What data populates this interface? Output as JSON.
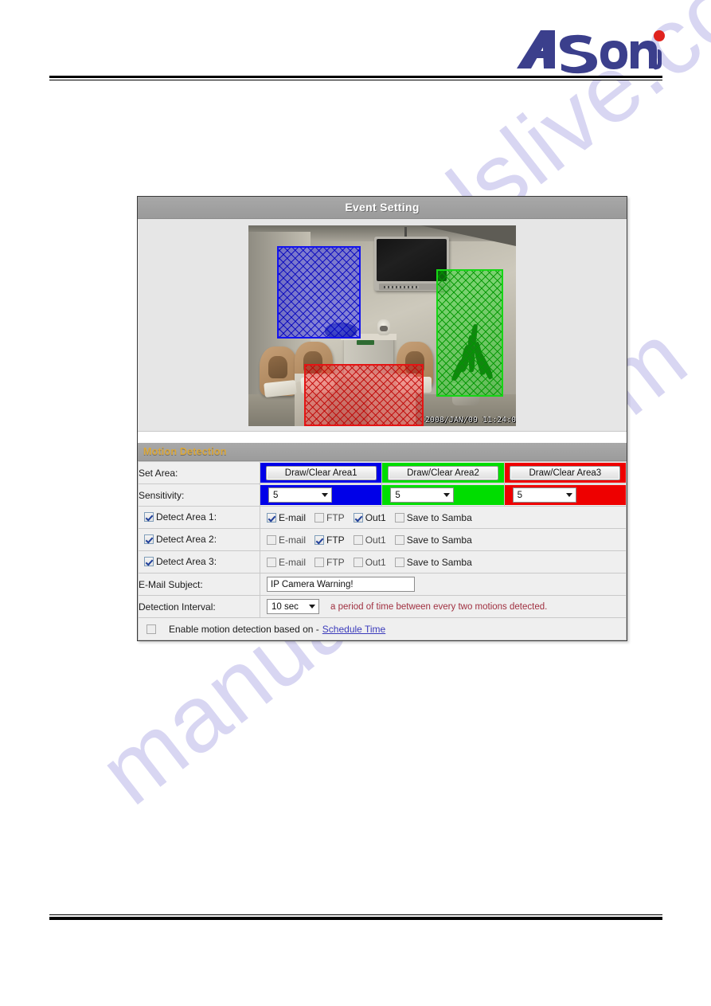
{
  "brand": {
    "logo_text": "Asoni",
    "logo_color": "#3b3f8c",
    "dot_color": "#e0231e"
  },
  "watermark": {
    "text": "manualslive.com",
    "color": "#b9b6e8"
  },
  "panel": {
    "title": "Event Setting",
    "section_title": "Motion Detection",
    "section_title_color": "#dba83c"
  },
  "video": {
    "timestamp": "2008/JAN/09 11:24:0",
    "areas": [
      {
        "name": "area-1",
        "color": "#0000e8"
      },
      {
        "name": "area-2",
        "color": "#00dd00"
      },
      {
        "name": "area-3",
        "color": "#ee0000"
      }
    ]
  },
  "rows": {
    "set_area_label": "Set Area:",
    "sensitivity_label": "Sensitivity:",
    "email_subject_label": "E-Mail Subject:",
    "detection_interval_label": "Detection Interval:"
  },
  "set_area": {
    "buttons": [
      {
        "label": "Draw/Clear Area1",
        "color": "#0000e8"
      },
      {
        "label": "Draw/Clear Area2",
        "color": "#00dd00"
      },
      {
        "label": "Draw/Clear Area3",
        "color": "#ee0000"
      }
    ]
  },
  "sensitivity": {
    "values": [
      "5",
      "5",
      "5"
    ]
  },
  "detect_areas": [
    {
      "label": "Detect Area 1:",
      "enabled": true,
      "actions": [
        {
          "label": "E-mail",
          "checked": true
        },
        {
          "label": "FTP",
          "checked": false
        },
        {
          "label": "Out1",
          "checked": true
        },
        {
          "label": "Save to Samba",
          "checked": false
        }
      ]
    },
    {
      "label": "Detect Area 2:",
      "enabled": true,
      "actions": [
        {
          "label": "E-mail",
          "checked": false
        },
        {
          "label": "FTP",
          "checked": true
        },
        {
          "label": "Out1",
          "checked": false
        },
        {
          "label": "Save to Samba",
          "checked": false
        }
      ]
    },
    {
      "label": "Detect Area 3:",
      "enabled": true,
      "actions": [
        {
          "label": "E-mail",
          "checked": false
        },
        {
          "label": "FTP",
          "checked": false
        },
        {
          "label": "Out1",
          "checked": false
        },
        {
          "label": "Save to Samba",
          "checked": false
        }
      ]
    }
  ],
  "email_subject": {
    "value": "IP Camera Warning!",
    "placeholder": ""
  },
  "detection_interval": {
    "value": "10 sec",
    "hint": "a period of time between every two motions detected."
  },
  "schedule": {
    "checked": false,
    "label": "Enable motion detection based on -",
    "link": "Schedule Time"
  }
}
